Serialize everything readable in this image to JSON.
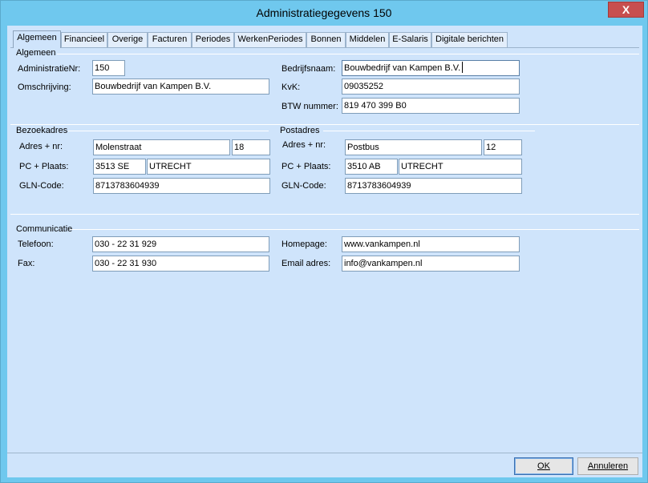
{
  "window": {
    "title": "Administratiegegevens 150",
    "close_label": "X"
  },
  "tabs": [
    "Algemeen",
    "Financieel",
    "Overige",
    "Facturen",
    "Periodes",
    "WerkenPeriodes",
    "Bonnen",
    "Middelen",
    "E-Salaris",
    "Digitale berichten"
  ],
  "algemeen": {
    "heading": "Algemeen",
    "administratienr_label": "AdministratieNr:",
    "administratienr": "150",
    "omschrijving_label": "Omschrijving:",
    "omschrijving": "Bouwbedrijf van Kampen B.V.",
    "bedrijfsnaam_label": "Bedrijfsnaam:",
    "bedrijfsnaam": "Bouwbedrijf van Kampen B.V.",
    "kvk_label": "KvK:",
    "kvk": "09035252",
    "btw_label": "BTW nummer:",
    "btw": "819 470 399 B0"
  },
  "bezoekadres": {
    "heading": "Bezoekadres",
    "adres_label": "Adres + nr:",
    "straat": "Molenstraat",
    "huisnummer": "18",
    "pc_label": "PC + Plaats:",
    "postcode": "3513 SE",
    "plaats": "UTRECHT",
    "gln_label": "GLN-Code:",
    "gln": "8713783604939"
  },
  "postadres": {
    "heading": "Postadres",
    "adres_label": "Adres + nr:",
    "straat": "Postbus",
    "huisnummer": "12",
    "pc_label": "PC + Plaats:",
    "postcode": "3510 AB",
    "plaats": "UTRECHT",
    "gln_label": "GLN-Code:",
    "gln": "8713783604939"
  },
  "communicatie": {
    "heading": "Communicatie",
    "telefoon_label": "Telefoon:",
    "telefoon": "030 - 22 31 929",
    "fax_label": "Fax:",
    "fax": "030 - 22 31 930",
    "homepage_label": "Homepage:",
    "homepage": "www.vankampen.nl",
    "email_label": "Email adres:",
    "email": "info@vankampen.nl"
  },
  "buttons": {
    "ok_label": "OK",
    "annuleren_label": "Annuleren"
  }
}
